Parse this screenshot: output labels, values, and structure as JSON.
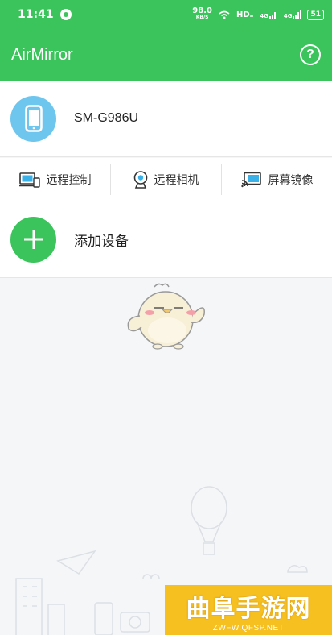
{
  "status_bar": {
    "time": "11:41",
    "net_speed": "98.0",
    "net_unit": "KB/S",
    "hd_label": "HDₐ",
    "signal1": "4G",
    "signal2": "4G",
    "battery": "51"
  },
  "app_bar": {
    "title": "AirMirror",
    "help_icon": "help-circle-icon",
    "help_glyph": "?"
  },
  "device": {
    "name": "SM-G986U",
    "icon": "phone-icon"
  },
  "actions": [
    {
      "label": "远程控制",
      "icon": "remote-control-icon"
    },
    {
      "label": "远程相机",
      "icon": "remote-camera-icon"
    },
    {
      "label": "屏幕镜像",
      "icon": "screen-mirror-icon"
    }
  ],
  "add_device": {
    "label": "添加设备",
    "icon": "plus-icon"
  },
  "watermark": {
    "title": "曲阜手游网",
    "subtitle": "ZWFW.QFSP.NET"
  },
  "colors": {
    "brand_green": "#3bc45b",
    "device_blue": "#6ec6ee",
    "watermark_yellow": "#f6c021"
  }
}
